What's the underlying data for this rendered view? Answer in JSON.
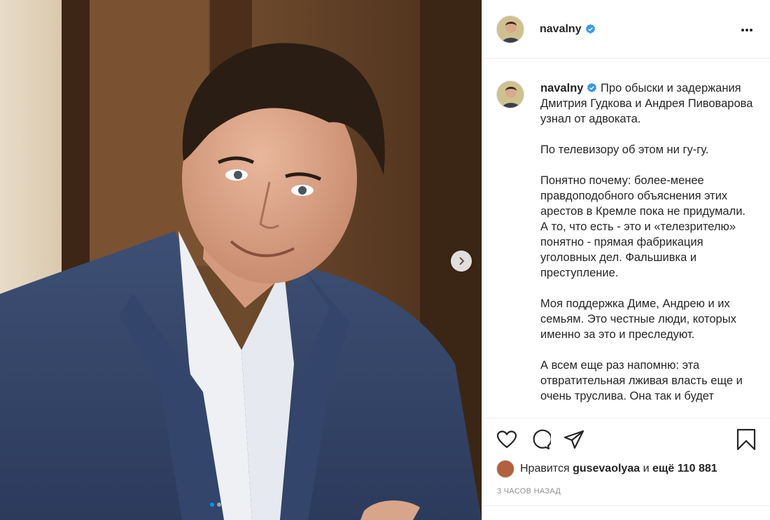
{
  "post": {
    "username": "navalny",
    "verified": true,
    "caption_paragraphs": [
      "Про обыски и задержания Дмитрия Гудкова и Андрея Пивоварова узнал от адвоката.",
      "По телевизору об этом ни гу-гу.",
      "Понятно почему: более-менее правдоподобного объяснения этих арестов в Кремле пока не придумали. А то, что есть - это и «телезрителю» понятно - прямая фабрикация уголовных дел. Фальшивка и преступление.",
      "Моя поддержка Диме, Андрею и их семьям. Это честные люди, которых именно за это и преследуют.",
      "А всем еще раз напомню: эта отвратительная лживая власть еще и очень труслива. Она так и будет"
    ]
  },
  "likes": {
    "prefix": "Нравится",
    "user": "gusevaolyaa",
    "middle": "и",
    "rest": "ещё 110 881"
  },
  "timestamp": "3 часов назад",
  "carousel": {
    "current": 1,
    "total": 2
  },
  "icons": {
    "verified": "verified-badge-icon",
    "more": "more-options-icon",
    "like": "heart-icon",
    "comment": "comment-icon",
    "share": "share-icon",
    "save": "bookmark-icon",
    "next": "chevron-right-icon"
  },
  "colors": {
    "verified": "#3897f0",
    "text": "#262626",
    "muted": "#8e8e8e",
    "border": "#efefef",
    "active_dot": "#0095f6"
  }
}
